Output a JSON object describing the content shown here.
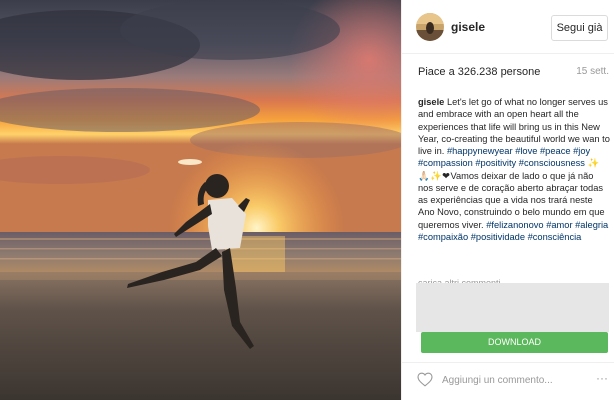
{
  "post": {
    "username": "gisele",
    "follow_label": "Segui già",
    "likes_text": "Piace a 326.238 persone",
    "date": "15 sett.",
    "caption": {
      "username": "gisele",
      "text_en": " Let's let go of what no longer serves us and embrace with an open heart all the experiences that life will bring us in this New Year, co-creating the beautiful world we wan to live in. ",
      "tags_en": [
        "#happynewyear",
        "#love",
        "#peace",
        "#joy",
        "#compassion",
        "#positivity",
        "#consciousness"
      ],
      "emoji": "✨🙏🏻✨❤",
      "text_pt": "Vamos deixar de lado o que já não nos serve e de coração aberto abraçar todas as experiências que a vida nos trará neste Ano Novo, construindo o belo mundo em que queremos viver. ",
      "tags_pt": [
        "#felizanonovo",
        "#amor",
        "#alegria",
        "#compaixão",
        "#positividade",
        "#consciência"
      ]
    },
    "more_comments_label": "carica altri commenti",
    "download_label": "DOWNLOAD",
    "comment_placeholder": "Aggiungi un commento...",
    "more_dots": "···"
  },
  "icons": {
    "like": "heart-outline-icon",
    "options": "more-options-icon"
  },
  "colors": {
    "hashtag": "#003569",
    "download_green": "#5cb85c",
    "meta_gray": "#999999",
    "border": "#efefef"
  }
}
